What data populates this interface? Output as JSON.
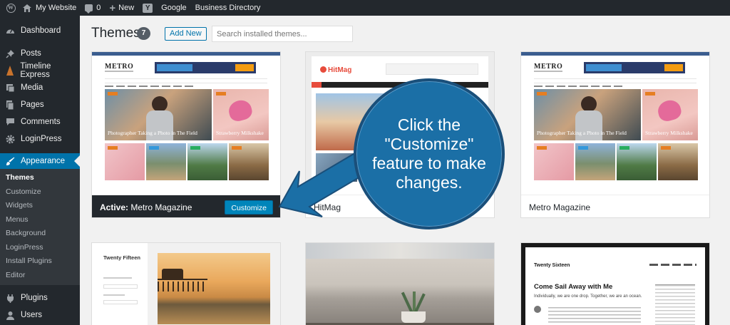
{
  "adminbar": {
    "site_name": "My Website",
    "comments_count": "0",
    "new_label": "New",
    "links": [
      "Google",
      "Business Directory"
    ]
  },
  "sidebar": {
    "items": [
      {
        "label": "Dashboard",
        "icon": "dashboard-icon"
      },
      {
        "label": "Posts",
        "icon": "pin-icon"
      },
      {
        "label": "Timeline Express",
        "icon": "timeline-icon"
      },
      {
        "label": "Media",
        "icon": "media-icon"
      },
      {
        "label": "Pages",
        "icon": "pages-icon"
      },
      {
        "label": "Comments",
        "icon": "comments-icon"
      },
      {
        "label": "LoginPress",
        "icon": "gear-icon"
      },
      {
        "label": "Appearance",
        "icon": "brush-icon"
      }
    ],
    "appearance_submenu": [
      "Themes",
      "Customize",
      "Widgets",
      "Menus",
      "Background",
      "LoginPress",
      "Install Plugins",
      "Editor"
    ],
    "after_items": [
      {
        "label": "Plugins",
        "icon": "plugin-icon"
      },
      {
        "label": "Users",
        "icon": "users-icon"
      }
    ]
  },
  "main": {
    "title": "Themes",
    "count": "7",
    "add_new_label": "Add New",
    "search_placeholder": "Search installed themes..."
  },
  "themes": {
    "active": {
      "prefix": "Active:",
      "name": "Metro Magazine",
      "customize_label": "Customize"
    },
    "hitmag": {
      "name": "HitMag"
    },
    "metro2": {
      "name": "Metro Magazine"
    },
    "twentyfifteen": {
      "title": "Twenty Fifteen"
    },
    "twentysixteen": {
      "title": "Twenty Sixteen",
      "post_title": "Come Sail Away with Me",
      "excerpt": "Individually, we are one drop. Together, we are an ocean."
    }
  },
  "screenshot_text": {
    "metro_logo": "METRO",
    "metro_caption_1": "Photographer Taking a Photo in The Field",
    "metro_caption_2": "Strawberry Milkshake",
    "hitmag_logo": "HitMag"
  },
  "callout": {
    "text": "Click the \"Customize\" feature to make changes."
  },
  "colors": {
    "admin_dark": "#23282d",
    "admin_blue": "#0073aa",
    "button_blue": "#0085ba",
    "callout_blue": "#1b6fa6"
  }
}
